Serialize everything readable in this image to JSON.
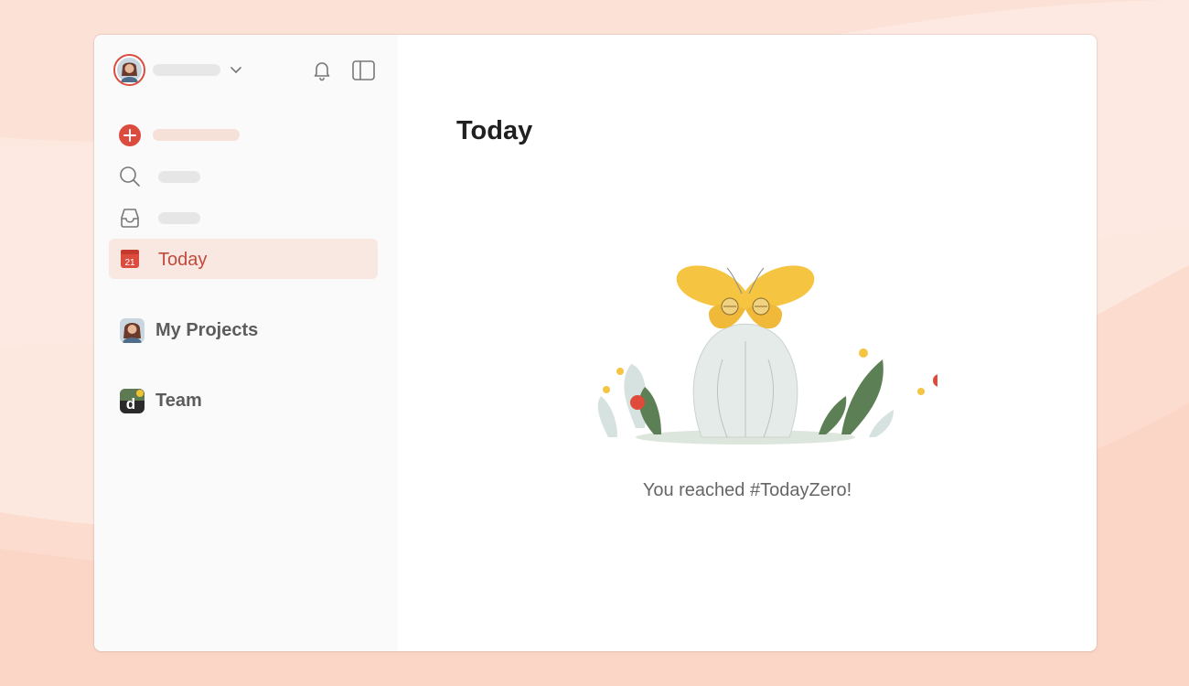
{
  "colors": {
    "accent": "#db4c3f",
    "today_highlight": "#f8e8e1",
    "today_text": "#c24a3c",
    "background": "#fde6dc",
    "sidebar_bg": "#fafafa"
  },
  "header": {
    "avatar_icon": "user-avatar",
    "menu_icon": "chevron-down-icon",
    "notifications_icon": "bell-icon",
    "sidebar_toggle_icon": "sidebar-panel-icon"
  },
  "sidebar": {
    "items": [
      {
        "id": "add-task",
        "icon": "plus-circle-icon"
      },
      {
        "id": "search",
        "icon": "search-icon"
      },
      {
        "id": "inbox",
        "icon": "inbox-icon"
      },
      {
        "id": "today",
        "icon": "calendar-icon",
        "label": "Today",
        "badge": "21"
      }
    ],
    "sections": [
      {
        "label": "My Projects",
        "icon": "user-avatar"
      },
      {
        "label": "Team",
        "icon": "team-logo"
      }
    ]
  },
  "main": {
    "title": "Today",
    "empty_state": {
      "message": "You reached #TodayZero!",
      "illustration": "butterfly-illustration"
    }
  }
}
